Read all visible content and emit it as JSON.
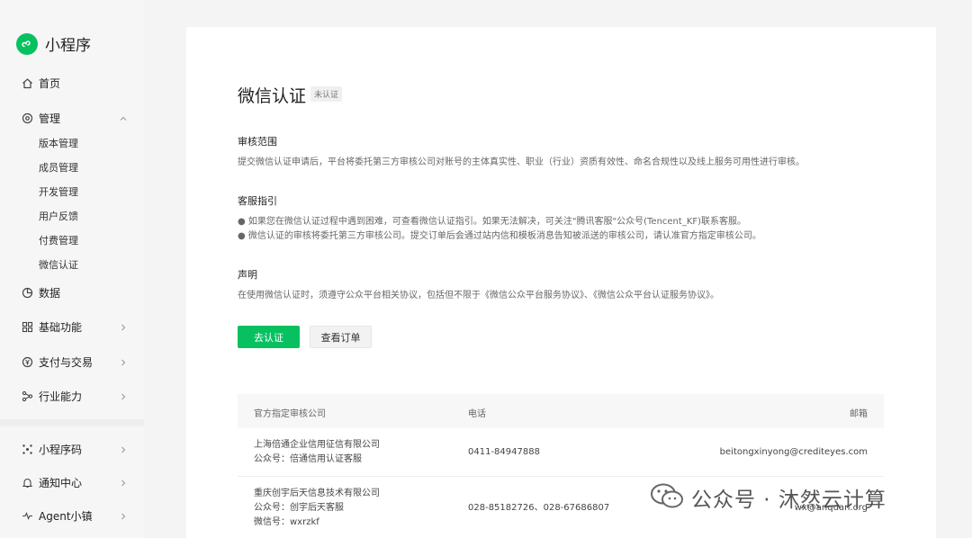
{
  "app": {
    "name": "小程序"
  },
  "sidebar": {
    "home": "首页",
    "manage": {
      "label": "管理",
      "items": [
        "版本管理",
        "成员管理",
        "开发管理",
        "用户反馈",
        "付费管理",
        "微信认证"
      ]
    },
    "data": "数据",
    "basic": "基础功能",
    "pay": "支付与交易",
    "industry": "行业能力",
    "qrcode": "小程序码",
    "notify": "通知中心",
    "agent": "Agent小镇"
  },
  "page": {
    "title": "微信认证",
    "badge": "未认证",
    "scope_title": "审核范围",
    "scope_body": "提交微信认证申请后，平台将委托第三方审核公司对账号的主体真实性、职业（行业）资质有效性、命名合规性以及线上服务可用性进行审核。",
    "service_title": "客服指引",
    "service_line1": "● 如果您在微信认证过程中遇到困难，可查看微信认证指引。如果无法解决，可关注\"腾讯客服\"公众号(Tencent_KF)联系客服。",
    "service_line2": "● 微信认证的审核将委托第三方审核公司。提交订单后会通过站内信和模板消息告知被派送的审核公司，请认准官方指定审核公司。",
    "statement_title": "声明",
    "statement_body": "在使用微信认证时，须遵守公众平台相关协议，包括但不限于《微信公众平台服务协议》、《微信公众平台认证服务协议》。",
    "btn_certify": "去认证",
    "btn_orders": "查看订单"
  },
  "table": {
    "headers": {
      "company": "官方指定审核公司",
      "phone": "电话",
      "email": "邮箱"
    },
    "rows": [
      {
        "company": "上海倍通企业信用征信有限公司",
        "account": "公众号：倍通信用认证客服",
        "phone": "0411-84947888",
        "email": "beitongxinyong@crediteyes.com"
      },
      {
        "company": "重庆创宇后天信息技术有限公司",
        "account": "公众号：创宇后天客服",
        "wechat": "微信号：wxrzkf",
        "phone": "028-85182726、028-67686807",
        "email": "wx@anquan.org"
      }
    ]
  },
  "watermark": {
    "text": "公众号 · 沐然云计算"
  },
  "colors": {
    "accent": "#07c160"
  }
}
